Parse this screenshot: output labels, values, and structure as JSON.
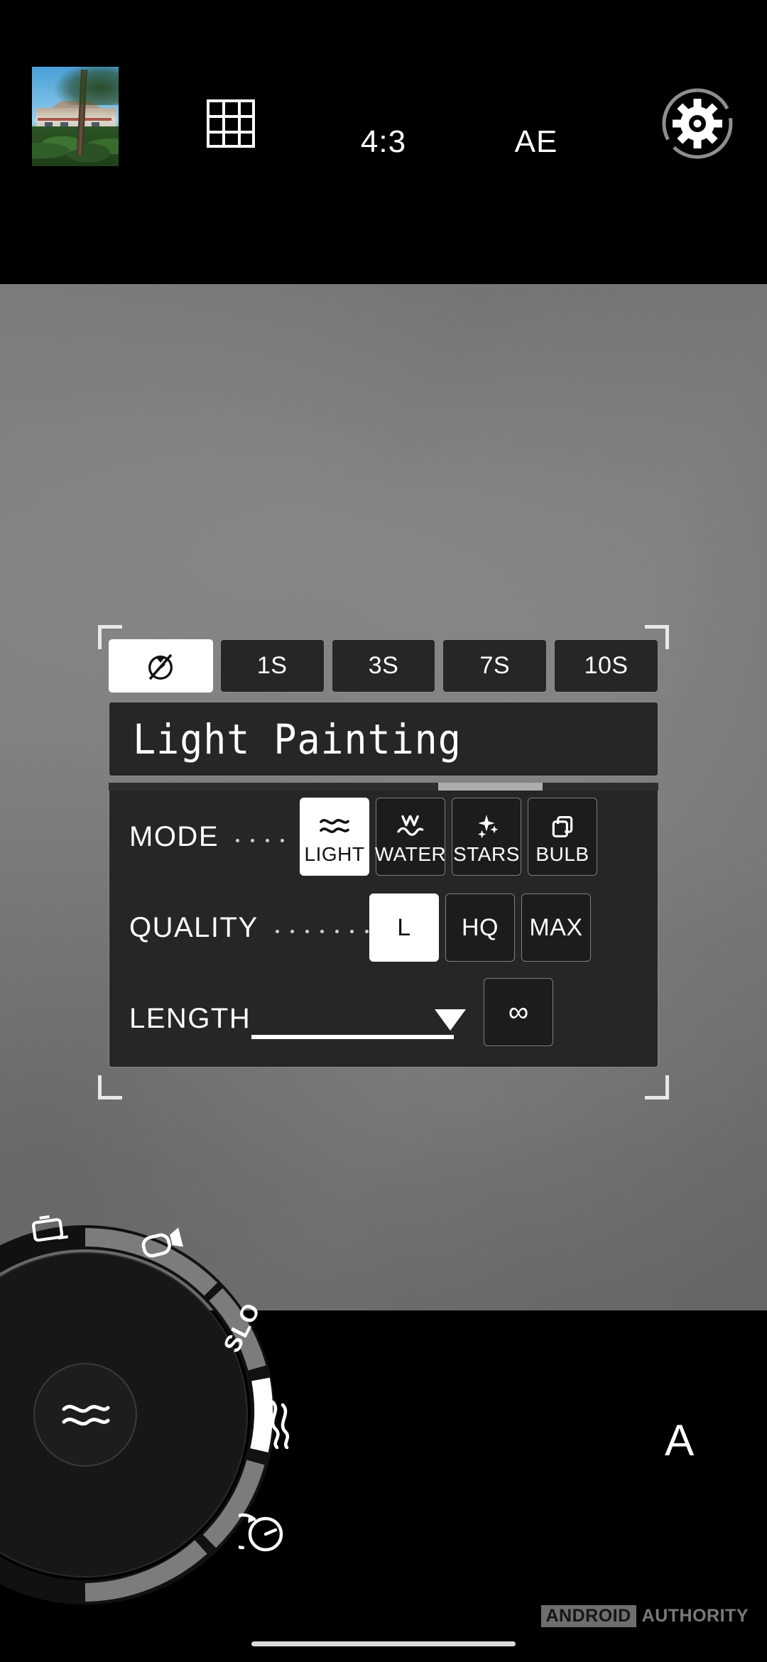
{
  "app": {
    "name": "Camera",
    "screen": "Light Painting mode settings"
  },
  "colors": {
    "selected_bg": "#ffffff",
    "selected_fg": "#111111",
    "button_bg": "#1c1c1c",
    "button_border": "#7e7e7e",
    "panel_bg": "#262626",
    "accent": "#ffffff",
    "viewfinder": "#7e7e7d",
    "watermark_box": "#6e6e6e",
    "watermark_text": "#7a7a7a"
  },
  "topbar": {
    "thumbnail": {
      "name": "last-photo-thumbnail",
      "alt": "building behind trees under blue sky"
    },
    "grid_icon": "grid-3x3-icon",
    "aspect_ratio": "4:3",
    "exposure_lock": "AE",
    "settings_icon": "gear-icon"
  },
  "panel": {
    "title": "Light Painting",
    "scrollbar": {
      "thumb_start_percent": 60,
      "thumb_width_percent": 19
    },
    "timer": {
      "name": "self-timer",
      "options": [
        {
          "id": "off",
          "label": "",
          "icon": "timer-off-icon",
          "selected": true
        },
        {
          "id": "1s",
          "label": "1S",
          "icon": "",
          "selected": false
        },
        {
          "id": "3s",
          "label": "3S",
          "icon": "",
          "selected": false
        },
        {
          "id": "7s",
          "label": "7S",
          "icon": "",
          "selected": false
        },
        {
          "id": "10s",
          "label": "10S",
          "icon": "",
          "selected": false
        }
      ]
    },
    "rows": [
      {
        "label": "MODE",
        "dots": 4,
        "options": [
          {
            "label": "LIGHT",
            "icon": "light-trails-wave-icon",
            "selected": true
          },
          {
            "label": "WATER",
            "icon": "water-flow-icon",
            "selected": false
          },
          {
            "label": "STARS",
            "icon": "star-sparkle-icon",
            "selected": false
          },
          {
            "label": "BULB",
            "icon": "bulb-layers-icon",
            "selected": false
          }
        ]
      },
      {
        "label": "QUALITY",
        "dots": 7,
        "options": [
          {
            "label": "L",
            "icon": "",
            "selected": true
          },
          {
            "label": "HQ",
            "icon": "",
            "selected": false
          },
          {
            "label": "MAX",
            "icon": "",
            "selected": false
          }
        ]
      },
      {
        "label": "LENGTH",
        "dots": 0,
        "slider": {
          "name": "length-slider",
          "value_percent": 100,
          "marker": "triangle-down-icon"
        },
        "options": [
          {
            "label": "∞",
            "icon": "infinity-icon",
            "selected": false
          }
        ]
      }
    ]
  },
  "mode_dial": {
    "name": "mode-dial",
    "current_icon": "light-trails-wave-icon",
    "current_mode": "Light Painting",
    "items": [
      {
        "label": "",
        "icon": "photo-camera-icon"
      },
      {
        "label": "",
        "icon": "video-camera-icon"
      },
      {
        "label": "SLO",
        "icon": ""
      },
      {
        "label": "",
        "icon": "light-trails-wave-icon",
        "selected": true
      },
      {
        "label": "",
        "icon": "timelapse-icon"
      }
    ]
  },
  "bottom": {
    "flash_mode": "A",
    "watermark": {
      "box": "ANDROID",
      "text": "AUTHORITY"
    },
    "nav_indicator": "home-gesture-bar"
  }
}
